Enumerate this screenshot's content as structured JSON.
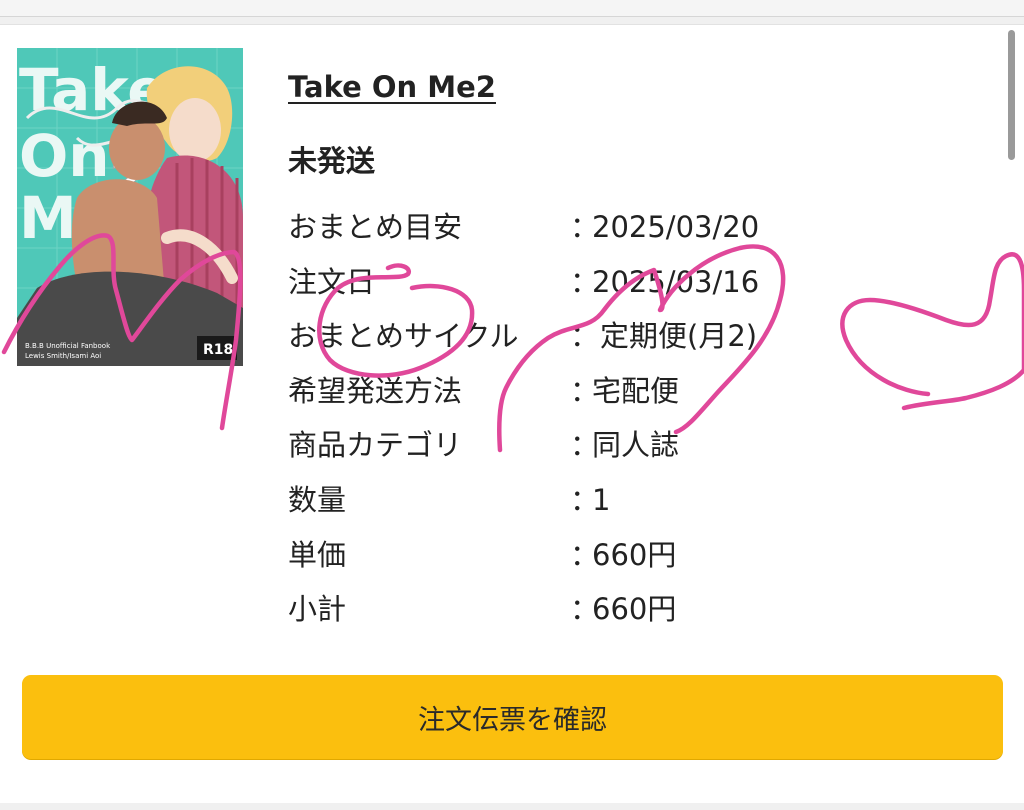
{
  "product": {
    "title": "Take On Me2",
    "status": "未発送",
    "cover": {
      "title_art": "Take On Me 2",
      "subtitle": "B.B.B Unofficial Fanbook",
      "authors": "Lewis Smith/Isami Aoi",
      "rating_badge": "R18"
    }
  },
  "details": [
    {
      "label": "おまとめ目安",
      "colon": "：",
      "value": "2025/03/20"
    },
    {
      "label": "注文日",
      "colon": "：",
      "value": "2025/03/16"
    },
    {
      "label": "おまとめサイクル",
      "colon": "：",
      "value": "定期便(月2)"
    },
    {
      "label": "希望発送方法",
      "colon": "：",
      "value": "宅配便"
    },
    {
      "label": "商品カテゴリ",
      "colon": "：",
      "value": "同人誌"
    },
    {
      "label": "数量",
      "colon": "：",
      "value": "1"
    },
    {
      "label": "単価",
      "colon": "：",
      "value": "660円"
    },
    {
      "label": "小計",
      "colon": "：",
      "value": "660円"
    }
  ],
  "actions": {
    "confirm_label": "注文伝票を確認"
  },
  "colors": {
    "button": "#fbbf0e",
    "cover_bg": "#4fc8b8",
    "doodle": "#e0489a"
  }
}
